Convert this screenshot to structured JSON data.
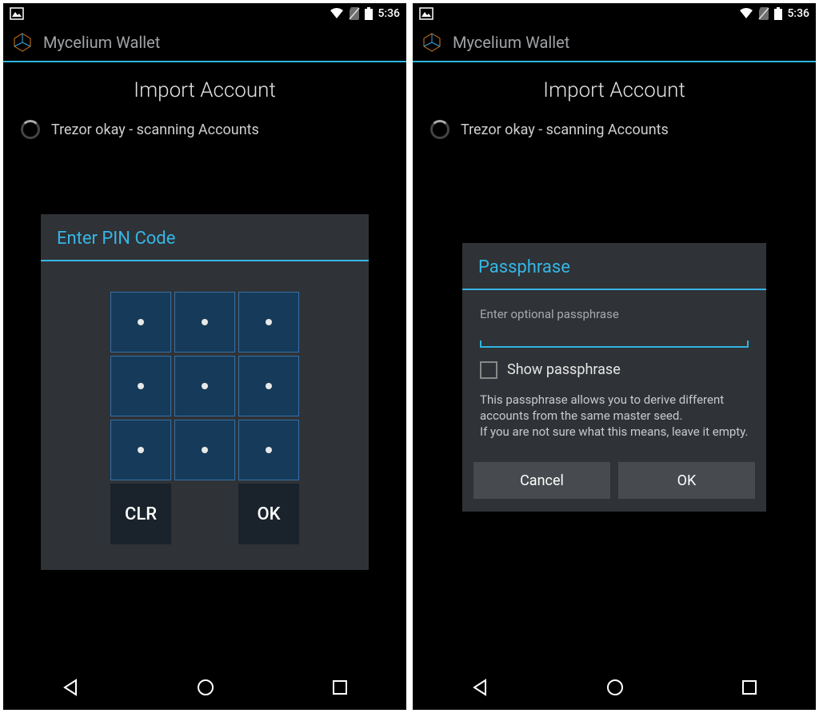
{
  "statusbar": {
    "time": "5:36"
  },
  "app": {
    "name": "Mycelium Wallet"
  },
  "page": {
    "title": "Import Account",
    "status_text": "Trezor okay - scanning Accounts"
  },
  "pin_dialog": {
    "title": "Enter PIN Code",
    "clr_label": "CLR",
    "ok_label": "OK"
  },
  "pass_dialog": {
    "title": "Passphrase",
    "placeholder": "Enter optional passphrase",
    "show_label": "Show passphrase",
    "help_text": "This passphrase allows you to derive different accounts from the same master seed.\nIf you are not sure what this means, leave it empty.",
    "cancel_label": "Cancel",
    "ok_label": "OK"
  }
}
